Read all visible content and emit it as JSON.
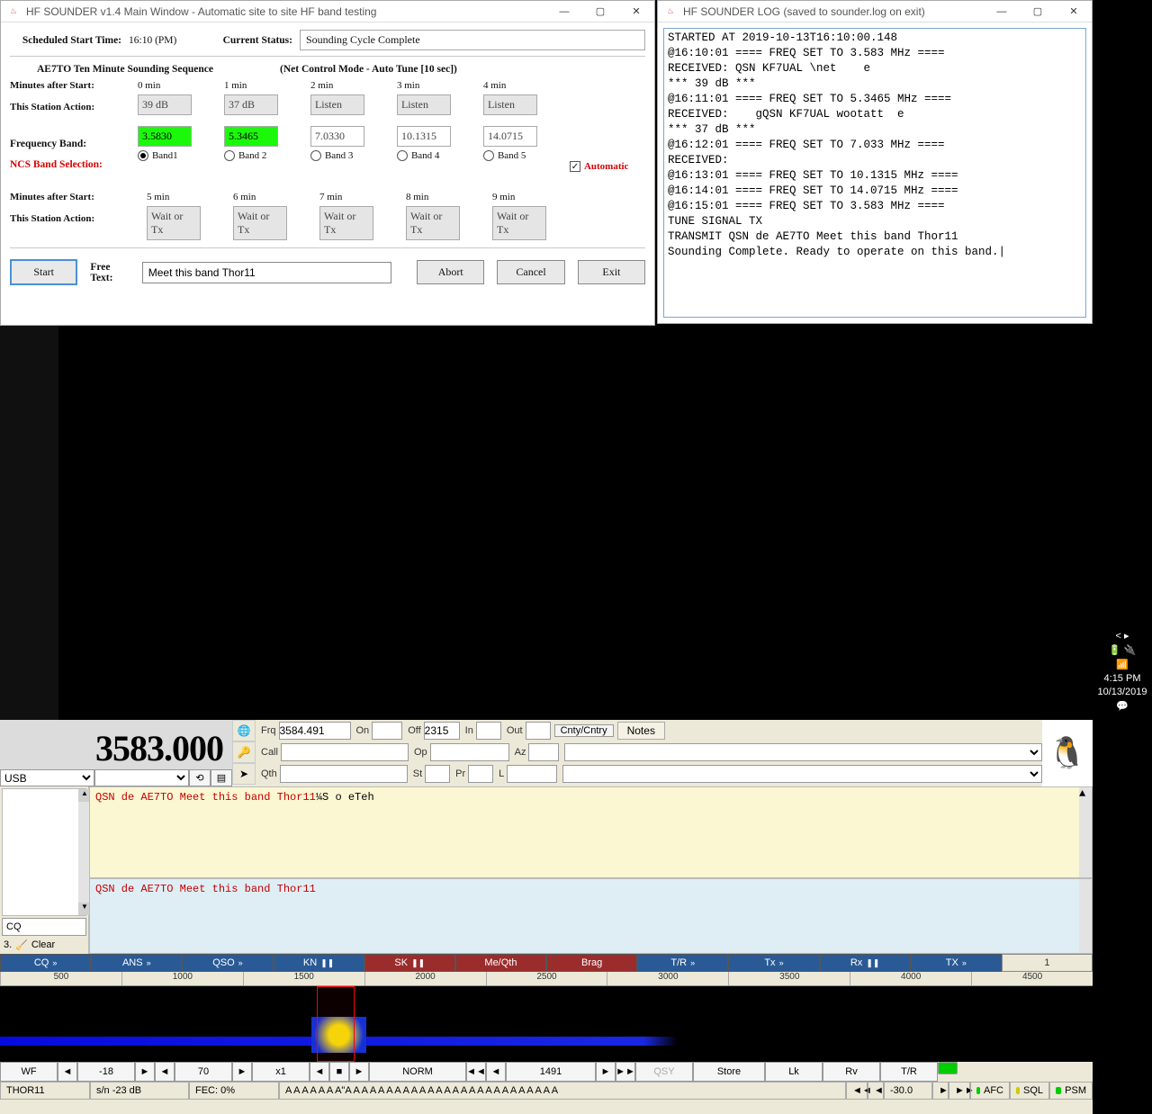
{
  "taskbar": {
    "time": "4:15 PM",
    "date": "10/13/2019"
  },
  "main": {
    "title": "HF SOUNDER v1.4 Main Window - Automatic site to site HF band testing",
    "scheduled_label": "Scheduled Start Time:",
    "scheduled_value": "16:10 (PM)",
    "status_label": "Current Status:",
    "status_value": "Sounding Cycle Complete",
    "seq_title": "AE7TO  Ten Minute Sounding Sequence",
    "mode_title": "(Net Control Mode - Auto Tune [10 sec])",
    "labels": {
      "min_after": "Minutes after Start:",
      "this_action": "This Station Action:",
      "freq_band": "Frequency Band:",
      "ncs": "NCS Band Selection:",
      "free_text": "Free Text:"
    },
    "cols_top": [
      {
        "min": "0 min",
        "action": "39 dB",
        "actCls": "",
        "freq": "3.5830",
        "freqCls": "gr",
        "band": "Band1",
        "on": true
      },
      {
        "min": "1 min",
        "action": "37 dB",
        "actCls": "",
        "freq": "5.3465",
        "freqCls": "gr",
        "band": "Band 2",
        "on": false
      },
      {
        "min": "2 min",
        "action": "Listen",
        "actCls": "",
        "freq": "7.0330",
        "freqCls": "wt",
        "band": "Band 3",
        "on": false
      },
      {
        "min": "3 min",
        "action": "Listen",
        "actCls": "",
        "freq": "10.1315",
        "freqCls": "wt",
        "band": "Band 4",
        "on": false
      },
      {
        "min": "4 min",
        "action": "Listen",
        "actCls": "",
        "freq": "14.0715",
        "freqCls": "wt",
        "band": "Band 5",
        "on": false
      }
    ],
    "auto_label": "Automatic",
    "cols_bot": [
      {
        "min": "5 min",
        "action": "Wait or Tx"
      },
      {
        "min": "6 min",
        "action": "Wait or Tx"
      },
      {
        "min": "7 min",
        "action": "Wait or Tx"
      },
      {
        "min": "8 min",
        "action": "Wait or Tx"
      },
      {
        "min": "9 min",
        "action": "Wait or Tx"
      }
    ],
    "buttons": {
      "start": "Start",
      "abort": "Abort",
      "cancel": "Cancel",
      "exit": "Exit"
    },
    "free_text_value": "Meet this band Thor11"
  },
  "log": {
    "title": "HF SOUNDER LOG (saved to sounder.log on exit)",
    "content": "STARTED AT 2019-10-13T16:10:00.148\n@16:10:01 ==== FREQ SET TO 3.583 MHz ====\nRECEIVED: QSN KF7UAL \\net    e\n*** 39 dB ***\n@16:11:01 ==== FREQ SET TO 5.3465 MHz ====\nRECEIVED:    gQSN KF7UAL wootatt  e\n*** 37 dB ***\n@16:12:01 ==== FREQ SET TO 7.033 MHz ====\nRECEIVED:\n@16:13:01 ==== FREQ SET TO 10.1315 MHz ====\n@16:14:01 ==== FREQ SET TO 14.0715 MHz ====\n@16:15:01 ==== FREQ SET TO 3.583 MHz ====\nTUNE SIGNAL TX\nTRANSMIT QSN de AE7TO Meet this band Thor11\nSounding Complete. Ready to operate on this band.|"
  },
  "fldigi": {
    "freq_display": "3583.000",
    "mode_sel": "USB",
    "fields": {
      "freq": {
        "label": "Frq",
        "value": "3584.491"
      },
      "on": {
        "label": "On",
        "value": ""
      },
      "off": {
        "label": "Off",
        "value": "2315"
      },
      "in": {
        "label": "In",
        "value": ""
      },
      "out": {
        "label": "Out",
        "value": ""
      },
      "cnty": {
        "label": "Cnty/Cntry",
        "value": ""
      },
      "notes": "Notes",
      "call": {
        "label": "Call",
        "value": ""
      },
      "op": {
        "label": "Op",
        "value": ""
      },
      "az": {
        "label": "Az",
        "value": ""
      },
      "qth": {
        "label": "Qth",
        "value": ""
      },
      "st": {
        "label": "St",
        "value": ""
      },
      "pr": {
        "label": "Pr",
        "value": ""
      },
      "l": {
        "label": "L",
        "value": ""
      }
    },
    "side": {
      "cq": "CQ",
      "clear": "Clear",
      "num": "3."
    },
    "rx_red": "QSN de AE7TO Meet this band Thor11",
    "rx_blk": "¼S o eTeh",
    "tx": "QSN de AE7TO Meet this band Thor11",
    "macros": [
      "CQ",
      "ANS",
      "QSO",
      "KN",
      "SK",
      "Me/Qth",
      "Brag",
      "T/R",
      "Tx",
      "Rx",
      "TX"
    ],
    "macro_num": "1",
    "wf_ticks": [
      "500",
      "1000",
      "1500",
      "2000",
      "2500",
      "3000",
      "3500",
      "4000",
      "4500"
    ],
    "wf_ctrl": {
      "wf": "WF",
      "v1": "-18",
      "v2": "70",
      "x": "x1",
      "norm": "NORM",
      "cursor": "1491",
      "qsy": "QSY",
      "store": "Store",
      "lk": "Lk",
      "rv": "Rv",
      "tr": "T/R"
    },
    "status": {
      "mode": "THOR11",
      "sn": "s/n -23 dB",
      "fec": "FEC:    0%",
      "text": "A A A A A A A\"A A A   A         A A    A A                  A A A A       A A A A A A A A A A A A A A",
      "afc_val": "-30.0",
      "afc": "AFC",
      "sql": "SQL",
      "psm": "PSM"
    }
  }
}
